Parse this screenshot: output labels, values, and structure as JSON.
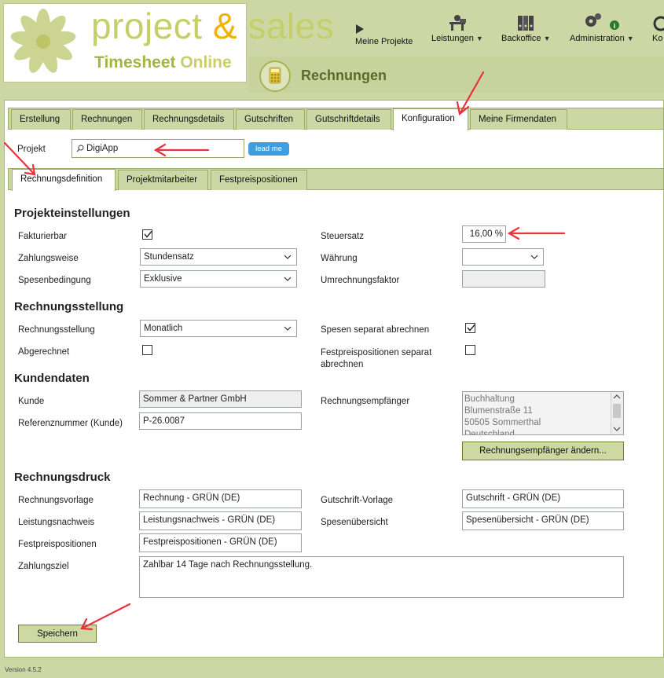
{
  "brand": {
    "name_part1": "project ",
    "amp": "&",
    "name_part2": " sales",
    "sub1": "Timesheet",
    "sub2": "Online"
  },
  "nav": {
    "items": [
      {
        "label": "Meine Projekte",
        "icon": "play-icon",
        "caret": ""
      },
      {
        "label": "Leistungen",
        "icon": "worker-desk-icon",
        "caret": "▼"
      },
      {
        "label": "Backoffice",
        "icon": "binders-icon",
        "caret": "▼"
      },
      {
        "label": "Administration",
        "icon": "gears-icon",
        "caret": "▼"
      },
      {
        "label": "Ko",
        "icon": "settings-icon",
        "caret": ""
      }
    ]
  },
  "page": {
    "title": "Rechnungen",
    "icon": "calculator-icon"
  },
  "tabs": [
    {
      "label": "Erstellung"
    },
    {
      "label": "Rechnungen"
    },
    {
      "label": "Rechnungsdetails"
    },
    {
      "label": "Gutschriften"
    },
    {
      "label": "Gutschriftdetails"
    },
    {
      "label": "Konfiguration",
      "active": true
    },
    {
      "label": "Meine Firmendaten"
    }
  ],
  "projekt": {
    "label": "Projekt",
    "value": "DigiApp",
    "lead_button": "lead me"
  },
  "subtabs": [
    {
      "label": "Rechnungsdefinition",
      "active": true
    },
    {
      "label": "Projektmitarbeiter"
    },
    {
      "label": "Festpreispositionen"
    }
  ],
  "sections": {
    "projekteinstellungen": {
      "title": "Projekteinstellungen",
      "fakturierbar_label": "Fakturierbar",
      "fakturierbar_checked": true,
      "zahlungsweise_label": "Zahlungsweise",
      "zahlungsweise_value": "Stundensatz",
      "spesenbedingung_label": "Spesenbedingung",
      "spesenbedingung_value": "Exklusive",
      "steuersatz_label": "Steuersatz",
      "steuersatz_value": "16,00 %",
      "waehrung_label": "Währung",
      "waehrung_value": "",
      "umrechnungsfaktor_label": "Umrechnungsfaktor",
      "umrechnungsfaktor_value": ""
    },
    "rechnungsstellung": {
      "title": "Rechnungsstellung",
      "rechnungsstellung_label": "Rechnungsstellung",
      "rechnungsstellung_value": "Monatlich",
      "abgerechnet_label": "Abgerechnet",
      "abgerechnet_checked": false,
      "spesen_separat_label": "Spesen separat abrechnen",
      "spesen_separat_checked": true,
      "festpreis_separat_label_1": "Festpreispositionen separat",
      "festpreis_separat_label_2": "abrechnen",
      "festpreis_separat_checked": false
    },
    "kundendaten": {
      "title": "Kundendaten",
      "kunde_label": "Kunde",
      "kunde_value": "Sommer & Partner GmbH",
      "referenz_label": "Referenznummer (Kunde)",
      "referenz_value": "P-26.0087",
      "empfaenger_label": "Rechnungsempfänger",
      "empfaenger_lines": [
        "Buchhaltung",
        "Blumenstraße 11",
        "50505 Sommerthal",
        "Deutschland"
      ],
      "empfaenger_button": "Rechnungsempfänger ändern..."
    },
    "rechnungsdruck": {
      "title": "Rechnungsdruck",
      "rechnungsvorlage_label": "Rechnungsvorlage",
      "rechnungsvorlage_value": "Rechnung - GRÜN (DE)",
      "leistungsnachweis_label": "Leistungsnachweis",
      "leistungsnachweis_value": "Leistungsnachweis - GRÜN (DE)",
      "festpreispositionen_label": "Festpreispositionen",
      "festpreispositionen_value": "Festpreispositionen - GRÜN (DE)",
      "gutschrift_label": "Gutschrift-Vorlage",
      "gutschrift_value": "Gutschrift - GRÜN (DE)",
      "spesenuebersicht_label": "Spesenübersicht",
      "spesenuebersicht_value": "Spesenübersicht - GRÜN (DE)",
      "zahlungsziel_label": "Zahlungsziel",
      "zahlungsziel_value": "Zahlbar 14 Tage nach Rechnungsstellung."
    }
  },
  "actions": {
    "save_label": "Speichern"
  },
  "footer": {
    "version": "Version 4.5.2"
  },
  "colors": {
    "accent_green": "#cdd7a6",
    "brand_light": "#c5cf68",
    "brand_amp": "#f0b400",
    "annotation_red": "#e8323c",
    "lead_blue": "#3e9ee0"
  }
}
